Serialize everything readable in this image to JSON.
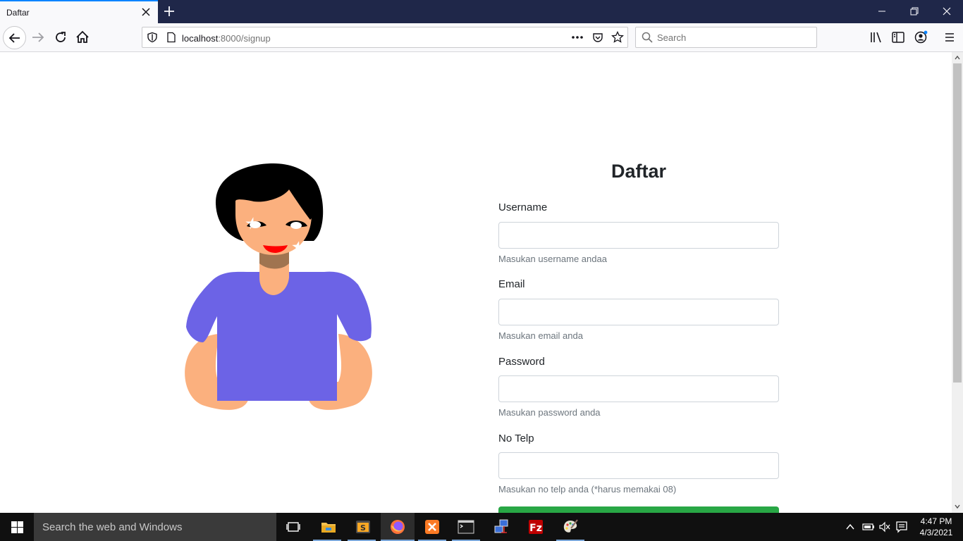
{
  "browser": {
    "tab_title": "Daftar",
    "url_host": "localhost",
    "url_rest": ":8000/signup",
    "search_placeholder": "Search",
    "accent_color": "#0a84ff"
  },
  "form": {
    "title": "Daftar",
    "fields": [
      {
        "label": "Username",
        "help": "Masukan username andaa",
        "value": ""
      },
      {
        "label": "Email",
        "help": "Masukan email anda",
        "value": ""
      },
      {
        "label": "Password",
        "help": "Masukan password anda",
        "value": ""
      },
      {
        "label": "No Telp",
        "help": "Masukan no telp anda (*harus memakai 08)",
        "value": ""
      }
    ],
    "submit_color": "#28a745"
  },
  "taskbar": {
    "search_placeholder": "Search the web and Windows",
    "time": "4:47 PM",
    "date": "4/3/2021"
  },
  "icons": [
    "close-icon",
    "plus-icon",
    "minimize-icon",
    "restore-icon",
    "back-arrow-icon",
    "forward-arrow-icon",
    "reload-icon",
    "home-icon",
    "shield-icon",
    "page-icon",
    "more-dots-icon",
    "pocket-icon",
    "star-icon",
    "search-icon",
    "library-icon",
    "sidebar-icon",
    "account-icon",
    "hamburger-menu-icon",
    "windows-start-icon",
    "task-view-icon",
    "file-explorer-icon",
    "sublime-text-icon",
    "firefox-icon",
    "xampp-icon",
    "terminal-icon",
    "network-icon",
    "filezilla-icon",
    "paint-icon",
    "chevron-up-icon",
    "battery-icon",
    "volume-muted-icon",
    "notification-icon"
  ]
}
